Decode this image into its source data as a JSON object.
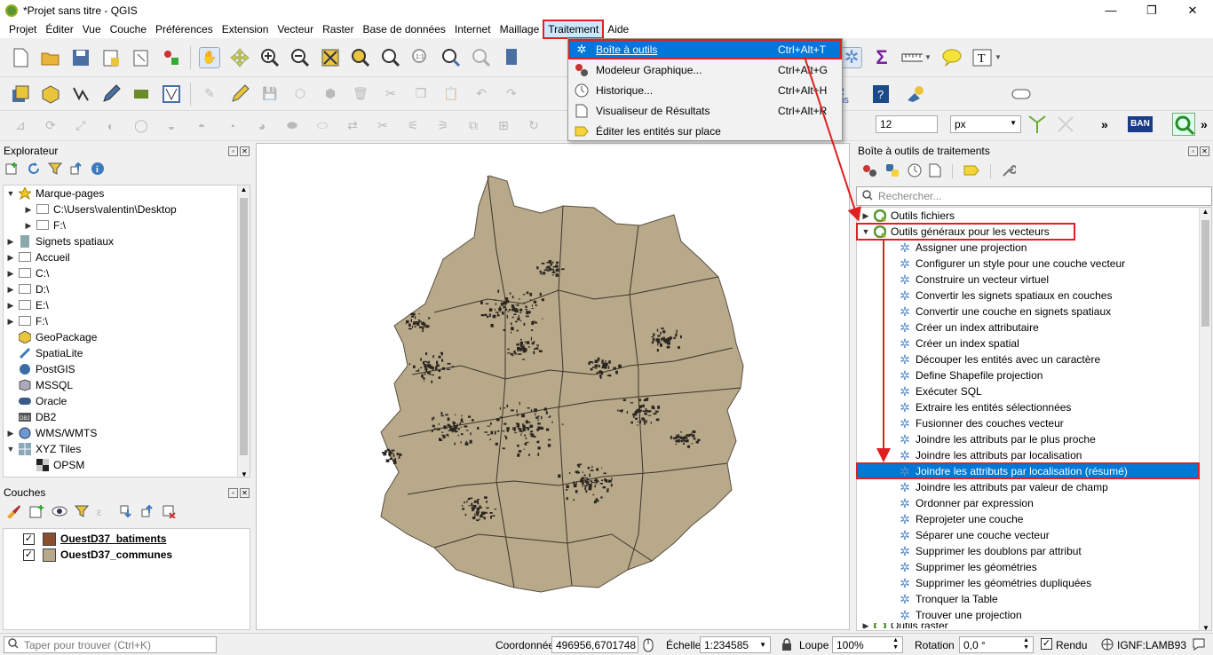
{
  "window": {
    "title": "*Projet sans titre - QGIS",
    "minimize": "—",
    "restore": "❐",
    "close": "✕"
  },
  "menubar": [
    "Projet",
    "Éditer",
    "Vue",
    "Couche",
    "Préférences",
    "Extension",
    "Vecteur",
    "Raster",
    "Base de données",
    "Internet",
    "Maillage",
    "Traitement",
    "Aide"
  ],
  "menu_traitement": {
    "items": [
      {
        "label": "Boîte à outils",
        "shortcut": "Ctrl+Alt+T",
        "icon": "gear-icon"
      },
      {
        "label": "Modeleur Graphique...",
        "shortcut": "Ctrl+Alt+G",
        "icon": "model-icon"
      },
      {
        "label": "Historique...",
        "shortcut": "Ctrl+Alt+H",
        "icon": "clock-icon"
      },
      {
        "label": "Visualiseur de Résultats",
        "shortcut": "Ctrl+Alt+R",
        "icon": "document-icon"
      },
      {
        "label": "Éditer les entités sur place",
        "shortcut": "",
        "icon": "pencil-icon"
      }
    ]
  },
  "toolbar3": {
    "font_size": "12",
    "unit": "px"
  },
  "browser": {
    "title": "Explorateur",
    "items": [
      {
        "label": "Marque-pages",
        "level": 0,
        "arrow": "▼",
        "icon": "star-icon"
      },
      {
        "label": "C:\\Users\\valentin\\Desktop",
        "level": 1,
        "arrow": "▶",
        "icon": "folder-icon"
      },
      {
        "label": "F:\\",
        "level": 1,
        "arrow": "▶",
        "icon": "folder-icon"
      },
      {
        "label": "Signets spatiaux",
        "level": 0,
        "arrow": "▶",
        "icon": "bookmark-icon"
      },
      {
        "label": "Accueil",
        "level": 0,
        "arrow": "▶",
        "icon": "folder-icon"
      },
      {
        "label": "C:\\",
        "level": 0,
        "arrow": "▶",
        "icon": "folder-icon"
      },
      {
        "label": "D:\\",
        "level": 0,
        "arrow": "▶",
        "icon": "folder-icon"
      },
      {
        "label": "E:\\",
        "level": 0,
        "arrow": "▶",
        "icon": "folder-icon"
      },
      {
        "label": "F:\\",
        "level": 0,
        "arrow": "▶",
        "icon": "folder-icon"
      },
      {
        "label": "GeoPackage",
        "level": 0,
        "arrow": "",
        "icon": "geopackage-icon"
      },
      {
        "label": "SpatiaLite",
        "level": 0,
        "arrow": "",
        "icon": "spatialite-icon"
      },
      {
        "label": "PostGIS",
        "level": 0,
        "arrow": "",
        "icon": "postgis-icon"
      },
      {
        "label": "MSSQL",
        "level": 0,
        "arrow": "",
        "icon": "mssql-icon"
      },
      {
        "label": "Oracle",
        "level": 0,
        "arrow": "",
        "icon": "oracle-icon"
      },
      {
        "label": "DB2",
        "level": 0,
        "arrow": "",
        "icon": "db2-icon"
      },
      {
        "label": "WMS/WMTS",
        "level": 0,
        "arrow": "▶",
        "icon": "globe-icon"
      },
      {
        "label": "XYZ Tiles",
        "level": 0,
        "arrow": "▼",
        "icon": "tiles-icon"
      },
      {
        "label": "OPSM",
        "level": 1,
        "arrow": "",
        "icon": "checker-icon"
      }
    ]
  },
  "layers": {
    "title": "Couches",
    "items": [
      {
        "label": "OuestD37_batiments",
        "checked": "✓",
        "color": "#8b4e2e"
      },
      {
        "label": "OuestD37_communes",
        "checked": "✓",
        "color": "#b8a98a"
      }
    ]
  },
  "toolbox": {
    "title": "Boîte à outils de traitements",
    "search_placeholder": "Rechercher...",
    "groups": [
      {
        "label": "Outils fichiers",
        "arrow": "▶"
      },
      {
        "label": "Outils généraux pour les vecteurs",
        "arrow": "▼"
      }
    ],
    "tools": [
      "Assigner une projection",
      "Configurer un style pour une couche vecteur",
      "Construire un vecteur virtuel",
      "Convertir les signets spatiaux en couches",
      "Convertir une couche en signets spatiaux",
      "Créer un index attributaire",
      "Créer un index spatial",
      "Découper les entités avec un caractère",
      "Define Shapefile projection",
      "Exécuter SQL",
      "Extraire les entités sélectionnées",
      "Fusionner des couches vecteur",
      "Joindre les attributs par le plus proche",
      "Joindre les attributs par localisation",
      "Joindre les attributs par localisation (résumé)",
      "Joindre les attributs par valeur de champ",
      "Ordonner par expression",
      "Reprojeter une couche",
      "Séparer une couche vecteur",
      "Supprimer les doublons par attribut",
      "Supprimer les géométries",
      "Supprimer les géométries dupliquées",
      "Tronquer la Table",
      "Trouver une projection"
    ],
    "selected_tool": "Joindre les attributs par localisation (résumé)",
    "next_group": "Outils raster"
  },
  "status": {
    "search_placeholder": "Taper pour trouver (Ctrl+K)",
    "coord_label": "Coordonnée",
    "coord_value": "496956,6701748",
    "scale_label": "Échelle",
    "scale_value": "1:234585",
    "zoom_label": "Loupe",
    "zoom_value": "100%",
    "rotation_label": "Rotation",
    "rotation_value": "0,0 °",
    "render_label": "Rendu",
    "crs": "IGNF:LAMB93"
  },
  "colors": {
    "accent": "#0078d7",
    "annotation": "#e02020",
    "map_fill": "#b8a98a",
    "buildings": "#2a2520"
  }
}
